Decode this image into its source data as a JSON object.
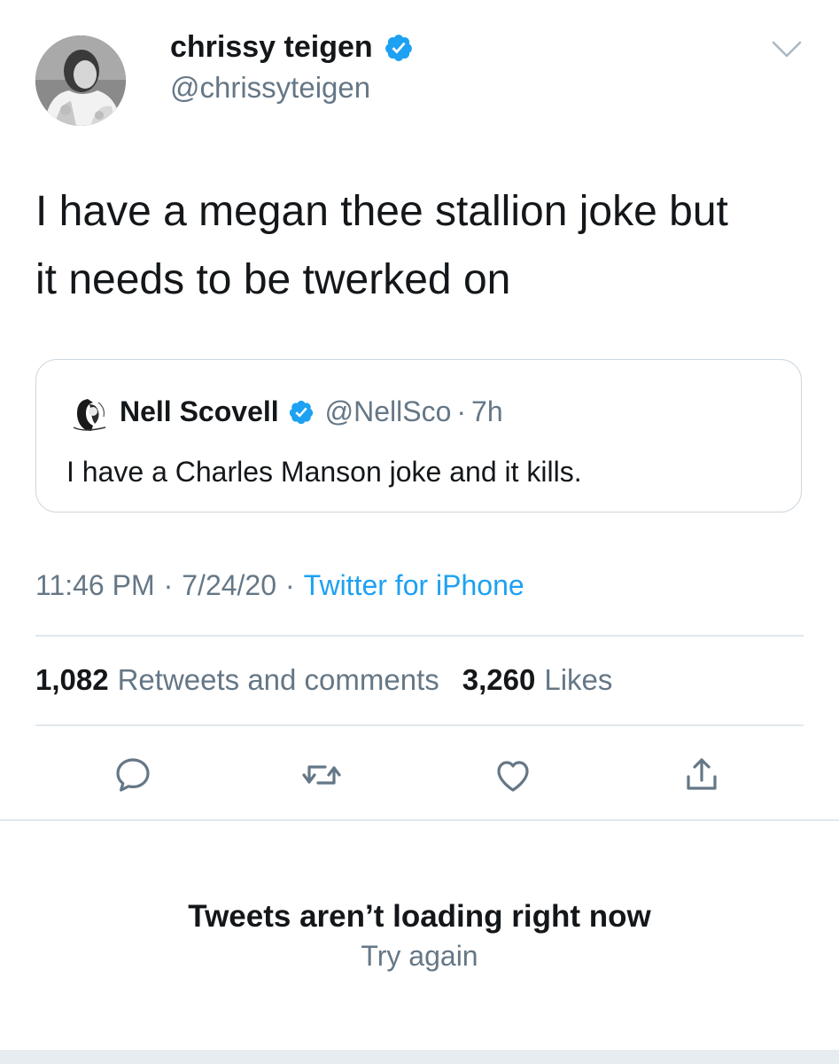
{
  "tweet": {
    "author": {
      "name": "chrissy teigen",
      "handle": "@chrissyteigen"
    },
    "text_line1": "I have a megan thee stallion joke but",
    "text_line2": "it needs to be twerked on",
    "quote": {
      "name": "Nell Scovell",
      "handle": "@NellSco",
      "separator": "·",
      "time": "7h",
      "text": "I have a Charles Manson joke and it kills."
    },
    "meta": {
      "time": "11:46 PM",
      "sep1": "·",
      "date": "7/24/20",
      "sep2": "·",
      "source": "Twitter for iPhone"
    },
    "stats": {
      "retweets_count": "1,082",
      "retweets_label": "Retweets and comments",
      "likes_count": "3,260",
      "likes_label": "Likes"
    },
    "actions": [
      "reply-icon",
      "retweet-icon",
      "like-icon",
      "share-icon"
    ]
  },
  "error": {
    "title": "Tweets aren’t loading right now",
    "retry": "Try again"
  },
  "colors": {
    "text": "#14171a",
    "secondary": "#657786",
    "link": "#1da1f2",
    "border": "#e1e8ed",
    "verified": "#1da1f2"
  }
}
